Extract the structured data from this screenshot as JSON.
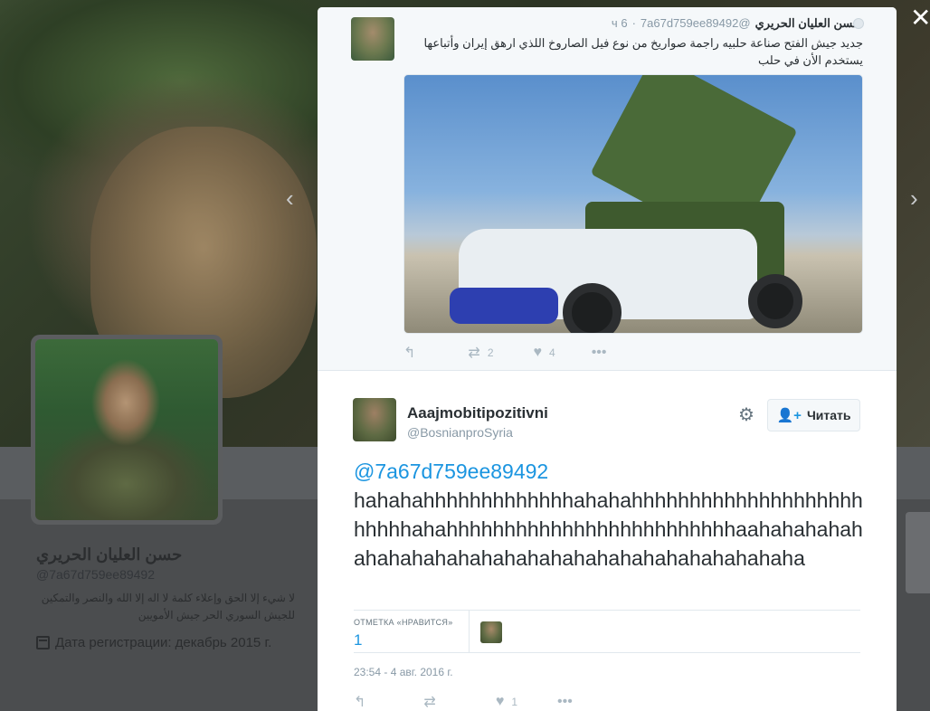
{
  "profile": {
    "name": "حسن العليان الحريري",
    "handle": "@7a67d759ee89492",
    "bio": "لا شيء إلا الحق وإعلاء كلمة لا اله إلا الله والنصر والتمكين للجيش السوري الحر جيش الأمويين",
    "joined": "Дата регистрации: декабрь 2015 г."
  },
  "nav": {
    "prev_icon": "‹",
    "next_icon": "›",
    "close_icon": "✕"
  },
  "ancestor_tweet": {
    "name": "حسن العليان الحريري",
    "handle": "@7a67d759ee89492",
    "time": "6 ч",
    "separator": "·",
    "text": "جديد جيش الفتح صناعة حلبيه راجمة صواريخ من نوع فيل الصاروخ اللذي ارهق إيران وأتباعها يستخدم الأن في حلب",
    "retweets": "2",
    "likes": "4"
  },
  "main_tweet": {
    "name": "Aaajmobitipozitivni",
    "handle": "@BosnianproSyria",
    "follow_label": "Читать",
    "mention": "@7a67d759ee89492",
    "text": "hahahahhhhhhhhhhhhhahahahhhhhhhhhhhhhhhhhhhhhhhhhahahhhhhhhhhhhhhhhhhhhhhhhhhaahahahahahahahahahahahahahahahahahahahahahahahaha",
    "likes_label": "ОТМЕТКА «НРАВИТСЯ»",
    "likes_count": "1",
    "timestamp": "23:54 - 4 авг. 2016 г.",
    "action_likes": "1"
  },
  "icons": {
    "reply": "reply-icon",
    "retweet": "retweet-icon",
    "like": "heart-icon",
    "more": "more-icon",
    "gear": "gear-icon",
    "follow": "follow-person-icon"
  },
  "colors": {
    "link": "#1b95e0",
    "text": "#292f33",
    "muted": "#8899a6"
  }
}
